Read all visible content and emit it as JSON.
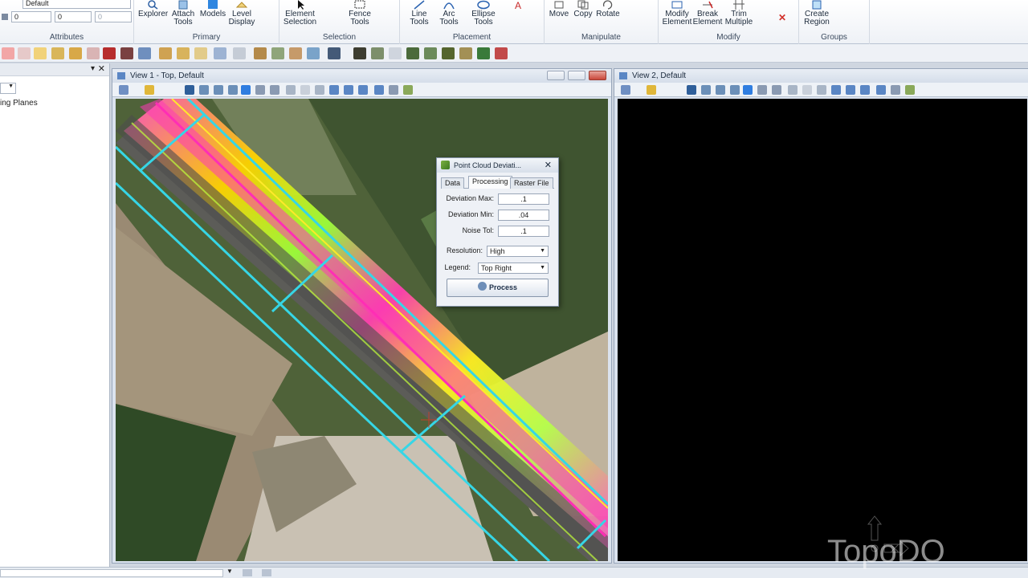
{
  "ribbon": {
    "attributes": {
      "label": "Attributes",
      "level_value": "Default",
      "field_a": "0",
      "field_b": "0",
      "field_c": "0"
    },
    "primary": {
      "label": "Primary",
      "explorer": "Explorer",
      "attach_tools": "Attach Tools",
      "models": "Models",
      "level_display": "Level Display"
    },
    "selection": {
      "label": "Selection",
      "element_selection": "Element Selection",
      "fence_tools": "Fence Tools"
    },
    "placement": {
      "label": "Placement",
      "line_tools": "Line Tools",
      "arc_tools": "Arc Tools",
      "ellipse_tools": "Ellipse Tools"
    },
    "manipulate": {
      "label": "Manipulate",
      "move": "Move",
      "copy": "Copy",
      "rotate": "Rotate"
    },
    "modify": {
      "label": "Modify",
      "modify_element": "Modify Element",
      "break_element": "Break Element",
      "trim_multiple": "Trim Multiple"
    },
    "groups": {
      "label": "Groups",
      "create_region": "Create Region"
    }
  },
  "left_panel": {
    "item": "ing Planes"
  },
  "view1": {
    "title": "View 1 - Top, Default"
  },
  "view2": {
    "title": "View 2, Default"
  },
  "dialog": {
    "title": "Point Cloud Deviati...",
    "tabs": [
      "Data",
      "Processing",
      "Raster File"
    ],
    "active_tab": "Processing",
    "deviation_max_label": "Deviation Max:",
    "deviation_max": ".1",
    "deviation_min_label": "Deviation Min:",
    "deviation_min": ".04",
    "noise_tol_label": "Noise Tol:",
    "noise_tol": ".1",
    "resolution_label": "Resolution:",
    "resolution": "High",
    "legend_label": "Legend:",
    "legend": "Top Right",
    "process_button": "Process"
  },
  "watermark": "TopoDO",
  "colors": {
    "view_background": "#000000",
    "boundary_cyan": "#36d6e6",
    "ribbon_bg": "#eef1f6"
  }
}
